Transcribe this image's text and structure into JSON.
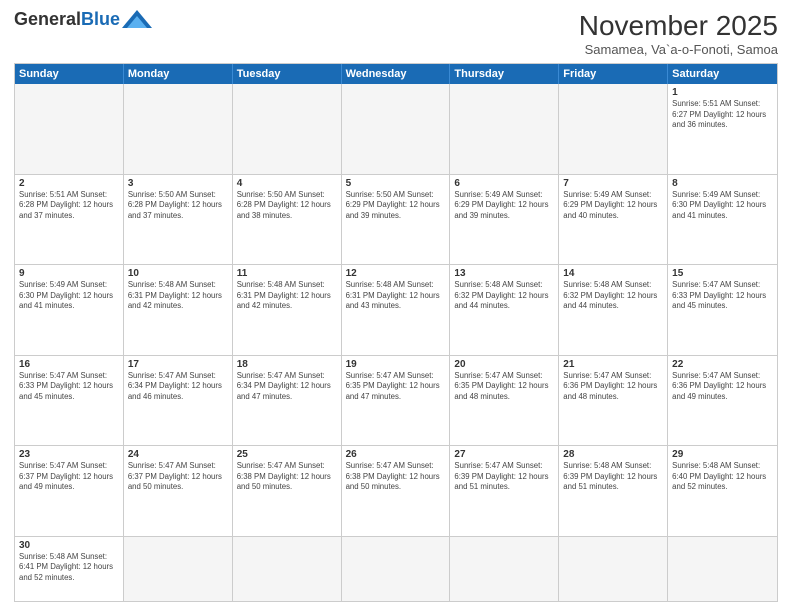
{
  "header": {
    "logo_general": "General",
    "logo_blue": "Blue",
    "month_title": "November 2025",
    "location": "Samamea, Va`a-o-Fonoti, Samoa"
  },
  "days_of_week": [
    "Sunday",
    "Monday",
    "Tuesday",
    "Wednesday",
    "Thursday",
    "Friday",
    "Saturday"
  ],
  "weeks": [
    [
      {
        "day": "",
        "info": "",
        "empty": true
      },
      {
        "day": "",
        "info": "",
        "empty": true
      },
      {
        "day": "",
        "info": "",
        "empty": true
      },
      {
        "day": "",
        "info": "",
        "empty": true
      },
      {
        "day": "",
        "info": "",
        "empty": true
      },
      {
        "day": "",
        "info": "",
        "empty": true
      },
      {
        "day": "1",
        "info": "Sunrise: 5:51 AM\nSunset: 6:27 PM\nDaylight: 12 hours and 36 minutes."
      }
    ],
    [
      {
        "day": "2",
        "info": "Sunrise: 5:51 AM\nSunset: 6:28 PM\nDaylight: 12 hours and 37 minutes."
      },
      {
        "day": "3",
        "info": "Sunrise: 5:50 AM\nSunset: 6:28 PM\nDaylight: 12 hours and 37 minutes."
      },
      {
        "day": "4",
        "info": "Sunrise: 5:50 AM\nSunset: 6:28 PM\nDaylight: 12 hours and 38 minutes."
      },
      {
        "day": "5",
        "info": "Sunrise: 5:50 AM\nSunset: 6:29 PM\nDaylight: 12 hours and 39 minutes."
      },
      {
        "day": "6",
        "info": "Sunrise: 5:49 AM\nSunset: 6:29 PM\nDaylight: 12 hours and 39 minutes."
      },
      {
        "day": "7",
        "info": "Sunrise: 5:49 AM\nSunset: 6:29 PM\nDaylight: 12 hours and 40 minutes."
      },
      {
        "day": "8",
        "info": "Sunrise: 5:49 AM\nSunset: 6:30 PM\nDaylight: 12 hours and 41 minutes."
      }
    ],
    [
      {
        "day": "9",
        "info": "Sunrise: 5:49 AM\nSunset: 6:30 PM\nDaylight: 12 hours and 41 minutes."
      },
      {
        "day": "10",
        "info": "Sunrise: 5:48 AM\nSunset: 6:31 PM\nDaylight: 12 hours and 42 minutes."
      },
      {
        "day": "11",
        "info": "Sunrise: 5:48 AM\nSunset: 6:31 PM\nDaylight: 12 hours and 42 minutes."
      },
      {
        "day": "12",
        "info": "Sunrise: 5:48 AM\nSunset: 6:31 PM\nDaylight: 12 hours and 43 minutes."
      },
      {
        "day": "13",
        "info": "Sunrise: 5:48 AM\nSunset: 6:32 PM\nDaylight: 12 hours and 44 minutes."
      },
      {
        "day": "14",
        "info": "Sunrise: 5:48 AM\nSunset: 6:32 PM\nDaylight: 12 hours and 44 minutes."
      },
      {
        "day": "15",
        "info": "Sunrise: 5:47 AM\nSunset: 6:33 PM\nDaylight: 12 hours and 45 minutes."
      }
    ],
    [
      {
        "day": "16",
        "info": "Sunrise: 5:47 AM\nSunset: 6:33 PM\nDaylight: 12 hours and 45 minutes."
      },
      {
        "day": "17",
        "info": "Sunrise: 5:47 AM\nSunset: 6:34 PM\nDaylight: 12 hours and 46 minutes."
      },
      {
        "day": "18",
        "info": "Sunrise: 5:47 AM\nSunset: 6:34 PM\nDaylight: 12 hours and 47 minutes."
      },
      {
        "day": "19",
        "info": "Sunrise: 5:47 AM\nSunset: 6:35 PM\nDaylight: 12 hours and 47 minutes."
      },
      {
        "day": "20",
        "info": "Sunrise: 5:47 AM\nSunset: 6:35 PM\nDaylight: 12 hours and 48 minutes."
      },
      {
        "day": "21",
        "info": "Sunrise: 5:47 AM\nSunset: 6:36 PM\nDaylight: 12 hours and 48 minutes."
      },
      {
        "day": "22",
        "info": "Sunrise: 5:47 AM\nSunset: 6:36 PM\nDaylight: 12 hours and 49 minutes."
      }
    ],
    [
      {
        "day": "23",
        "info": "Sunrise: 5:47 AM\nSunset: 6:37 PM\nDaylight: 12 hours and 49 minutes."
      },
      {
        "day": "24",
        "info": "Sunrise: 5:47 AM\nSunset: 6:37 PM\nDaylight: 12 hours and 50 minutes."
      },
      {
        "day": "25",
        "info": "Sunrise: 5:47 AM\nSunset: 6:38 PM\nDaylight: 12 hours and 50 minutes."
      },
      {
        "day": "26",
        "info": "Sunrise: 5:47 AM\nSunset: 6:38 PM\nDaylight: 12 hours and 50 minutes."
      },
      {
        "day": "27",
        "info": "Sunrise: 5:47 AM\nSunset: 6:39 PM\nDaylight: 12 hours and 51 minutes."
      },
      {
        "day": "28",
        "info": "Sunrise: 5:48 AM\nSunset: 6:39 PM\nDaylight: 12 hours and 51 minutes."
      },
      {
        "day": "29",
        "info": "Sunrise: 5:48 AM\nSunset: 6:40 PM\nDaylight: 12 hours and 52 minutes."
      }
    ],
    [
      {
        "day": "30",
        "info": "Sunrise: 5:48 AM\nSunset: 6:41 PM\nDaylight: 12 hours and 52 minutes."
      },
      {
        "day": "",
        "info": "",
        "empty": true
      },
      {
        "day": "",
        "info": "",
        "empty": true
      },
      {
        "day": "",
        "info": "",
        "empty": true
      },
      {
        "day": "",
        "info": "",
        "empty": true
      },
      {
        "day": "",
        "info": "",
        "empty": true
      },
      {
        "day": "",
        "info": "",
        "empty": true
      }
    ]
  ]
}
